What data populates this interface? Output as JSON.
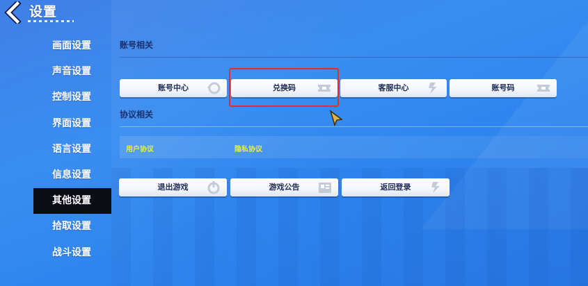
{
  "header": {
    "title": "设置",
    "back_icon": "back-chevron-icon"
  },
  "sidebar": {
    "items": [
      {
        "label": "画面设置",
        "active": false
      },
      {
        "label": "声音设置",
        "active": false
      },
      {
        "label": "控制设置",
        "active": false
      },
      {
        "label": "界面设置",
        "active": false
      },
      {
        "label": "语言设置",
        "active": false
      },
      {
        "label": "信息设置",
        "active": false
      },
      {
        "label": "其他设置",
        "active": true
      },
      {
        "label": "拾取设置",
        "active": false
      },
      {
        "label": "战斗设置",
        "active": false
      }
    ]
  },
  "account": {
    "title": "账号相关",
    "buttons": [
      {
        "label": "账号中心",
        "icon": "account-center-icon"
      },
      {
        "label": "兑换码",
        "icon": "ticket-icon",
        "highlighted": true
      },
      {
        "label": "客服中心",
        "icon": "customer-service-icon"
      },
      {
        "label": "账号码",
        "icon": "ticket-icon"
      }
    ]
  },
  "agreement": {
    "title": "协议相关",
    "links": [
      "用户协议",
      "隐私协议"
    ]
  },
  "system": {
    "buttons": [
      {
        "label": "退出游戏",
        "icon": "power-icon"
      },
      {
        "label": "游戏公告",
        "icon": "notice-icon"
      },
      {
        "label": "返回登录",
        "icon": "return-icon"
      }
    ]
  },
  "colors": {
    "highlight": "#e52b2b",
    "link": "#e4f23d",
    "active_tab": "#0c0c14"
  }
}
